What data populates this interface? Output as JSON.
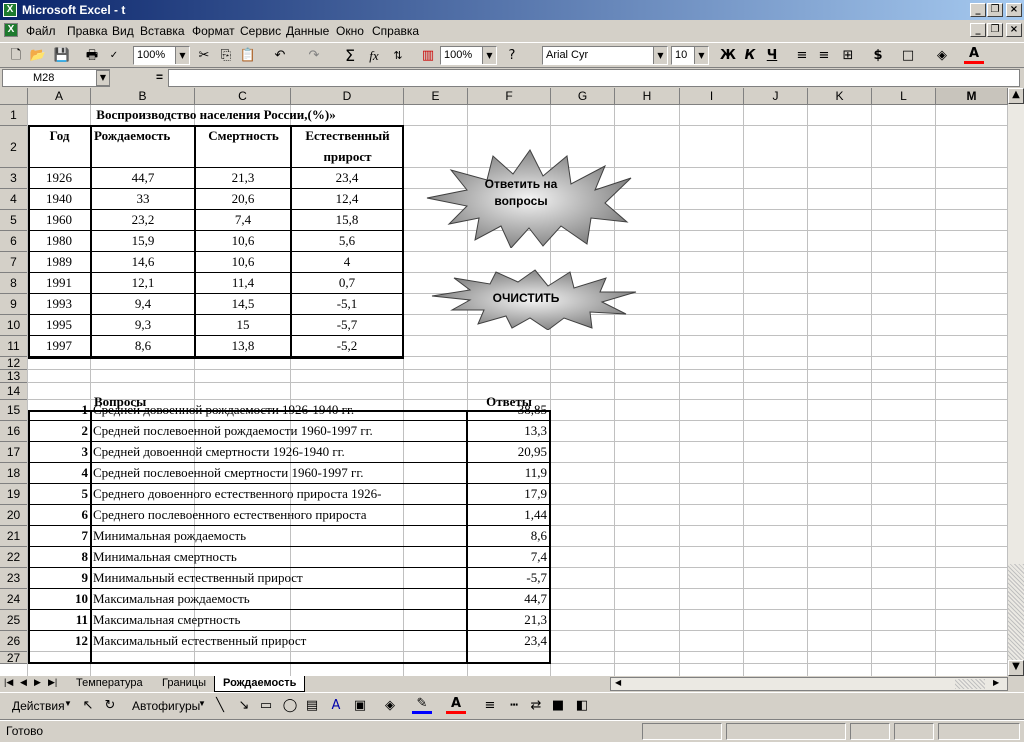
{
  "window": {
    "title": "Microsoft Excel - t",
    "app_icon": "excel-icon"
  },
  "menu": [
    "Файл",
    "Правка",
    "Вид",
    "Вставка",
    "Формат",
    "Сервис",
    "Данные",
    "Окно",
    "Справка"
  ],
  "toolbar": {
    "zoom1": "100%",
    "zoom2": "100%",
    "font": "Arial Cyr",
    "size": "10",
    "bold": "Ж",
    "italic": "К",
    "underline": "Ч",
    "currency": "$",
    "fx": "fx"
  },
  "formula": {
    "cell_ref": "M28",
    "eq": "="
  },
  "columns": [
    "A",
    "B",
    "C",
    "D",
    "E",
    "F",
    "G",
    "H",
    "I",
    "J",
    "K",
    "L",
    "M"
  ],
  "rows": [
    "1",
    "2",
    "3",
    "4",
    "5",
    "6",
    "7",
    "8",
    "9",
    "10",
    "11",
    "12",
    "13",
    "14",
    "15",
    "16",
    "17",
    "18",
    "19",
    "20",
    "21",
    "22",
    "23",
    "24",
    "25",
    "26",
    "27"
  ],
  "table": {
    "title": "Воспроизводство населения России,(%)»",
    "headers": [
      "Год",
      "Рождаемость",
      "Смертность",
      "Естественный",
      "прирост"
    ],
    "data": [
      [
        "1926",
        "44,7",
        "21,3",
        "23,4"
      ],
      [
        "1940",
        "33",
        "20,6",
        "12,4"
      ],
      [
        "1960",
        "23,2",
        "7,4",
        "15,8"
      ],
      [
        "1980",
        "15,9",
        "10,6",
        "5,6"
      ],
      [
        "1989",
        "14,6",
        "10,6",
        "4"
      ],
      [
        "1991",
        "12,1",
        "11,4",
        "0,7"
      ],
      [
        "1993",
        "9,4",
        "14,5",
        "-5,1"
      ],
      [
        "1995",
        "9,3",
        "15",
        "-5,7"
      ],
      [
        "1997",
        "8,6",
        "13,8",
        "-5,2"
      ]
    ]
  },
  "buttons": {
    "answer": "Ответить на вопросы",
    "answer_l1": "Ответить на",
    "answer_l2": "вопросы",
    "clear": "ОЧИСТИТЬ"
  },
  "qa": {
    "q_header": "Вопросы",
    "a_header": "Ответы",
    "items": [
      {
        "n": "1",
        "q": "Средней довоенной рождаемости 1926-1940 гг.",
        "a": "38,85"
      },
      {
        "n": "2",
        "q": "Средней послевоенной рождаемости 1960-1997 гг.",
        "a": "13,3"
      },
      {
        "n": "3",
        "q": "Средней довоенной смертности 1926-1940 гг.",
        "a": "20,95"
      },
      {
        "n": "4",
        "q": "Средней послевоенной смертности 1960-1997 гг.",
        "a": "11,9"
      },
      {
        "n": "5",
        "q": "Среднего довоенного естественного прироста 1926-",
        "a": "17,9"
      },
      {
        "n": "6",
        "q": "Среднего послевоенного естественного прироста",
        "a": "1,44"
      },
      {
        "n": "7",
        "q": "Минимальная рождаемость",
        "a": "8,6"
      },
      {
        "n": "8",
        "q": "Минимальная смертность",
        "a": "7,4"
      },
      {
        "n": "9",
        "q": "Минимальный естественный прирост",
        "a": "-5,7"
      },
      {
        "n": "10",
        "q": "Максимальная рождаемость",
        "a": "44,7"
      },
      {
        "n": "11",
        "q": "Максимальная смертность",
        "a": "21,3"
      },
      {
        "n": "12",
        "q": "Максимальный естественный прирост",
        "a": "23,4"
      }
    ]
  },
  "sheets": [
    "Температура",
    "Границы",
    "Рождаемость"
  ],
  "active_sheet": "Рождаемость",
  "drawing": {
    "actions": "Действия",
    "autoshapes": "Автофигуры"
  },
  "status": {
    "text": "Готово"
  }
}
